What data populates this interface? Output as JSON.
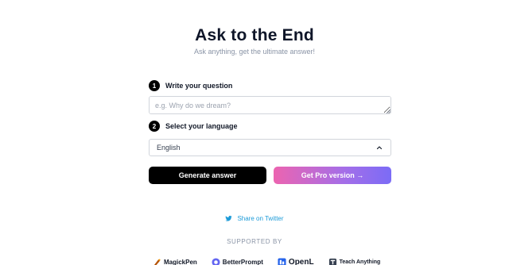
{
  "header": {
    "title": "Ask to the End",
    "subtitle": "Ask anything, get the ultimate answer!"
  },
  "steps": [
    {
      "number": "1",
      "label": "Write your question"
    },
    {
      "number": "2",
      "label": "Select your language"
    }
  ],
  "question_input": {
    "value": "",
    "placeholder": "e.g. Why do we dream?"
  },
  "language_select": {
    "selected": "English",
    "icon": "chevron-up-icon"
  },
  "actions": {
    "generate_label": "Generate answer",
    "pro_label": "Get Pro version →"
  },
  "share": {
    "label": "Share on Twitter",
    "icon": "twitter-icon"
  },
  "supported": {
    "heading": "SUPPORTED BY",
    "sponsors": [
      {
        "name": "MagickPen",
        "icon": "magickpen-logo"
      },
      {
        "name": "BetterPrompt",
        "icon": "betterprompt-logo"
      },
      {
        "name": "OpenL",
        "icon": "openl-logo"
      },
      {
        "name": "Teach Anything",
        "icon": "teach-anything-logo"
      }
    ]
  },
  "colors": {
    "title": "#0f1629",
    "subtitle": "#8a94a6",
    "primary_button": "#000000",
    "pro_gradient_start": "#ec64b0",
    "pro_gradient_end": "#7b6cf6",
    "twitter": "#1d9bd8"
  }
}
